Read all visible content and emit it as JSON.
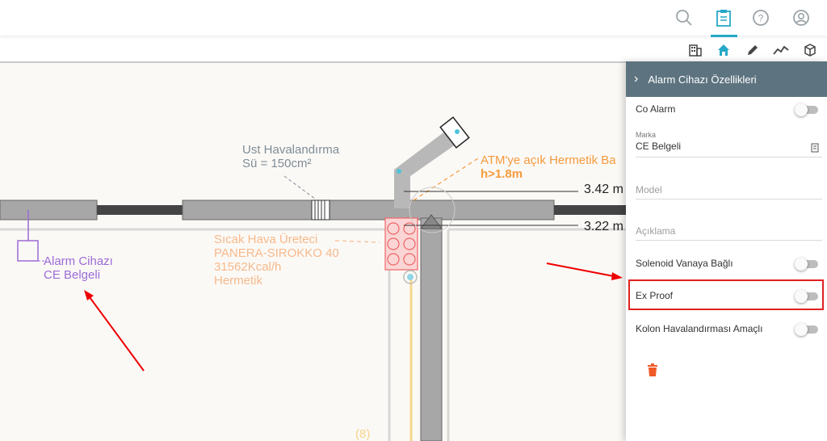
{
  "header": {
    "icons": [
      "search-icon",
      "clipboard-icon",
      "help-icon",
      "user-icon"
    ],
    "active_icon": "clipboard-icon",
    "accent_color": "#26a8c8"
  },
  "toolbar": {
    "icons": [
      "building-icon",
      "home-icon",
      "pencil-icon",
      "chart-line-icon",
      "cube-icon"
    ],
    "active_icon": "home-icon"
  },
  "canvas": {
    "labels": {
      "ventilation_line1": "Ust Havalandırma",
      "ventilation_line2": "Sü = 150cm²",
      "atm_line1": "ATM'ye açık Hermetik Ba",
      "atm_line2": "h>1.8m",
      "dim1": "3.42 m",
      "dim2": "3.22 m",
      "heater_line1": "Sıcak Hava Üreteci",
      "heater_line2": "PANERA-SIROKKO 40",
      "heater_line3": "31562Kcal/h",
      "heater_line4": "Hermetik",
      "alarm_line1": "Alarm Cihazı",
      "alarm_line2": "CE Belgeli",
      "bottom_mark": "(8)"
    },
    "colors": {
      "alarm": "#9b6bd6",
      "heater": "#f7b98b",
      "atm": "#f59a3c",
      "vent": "#7f8d96"
    }
  },
  "panel": {
    "title": "Alarm Cihazı Özellikleri",
    "header_color": "#5d7480",
    "co_alarm_label": "Co Alarm",
    "co_alarm_on": false,
    "marka_label": "Marka",
    "marka_value": "CE Belgeli",
    "model_placeholder": "Model",
    "aciklama_placeholder": "Açıklama",
    "solenoid_label": "Solenoid Vanaya Bağlı",
    "solenoid_on": false,
    "ex_proof_label": "Ex Proof",
    "ex_proof_on": false,
    "kolon_label": "Kolon Havalandırması Amaçlı",
    "kolon_on": false,
    "delete_color": "#f05a28"
  }
}
